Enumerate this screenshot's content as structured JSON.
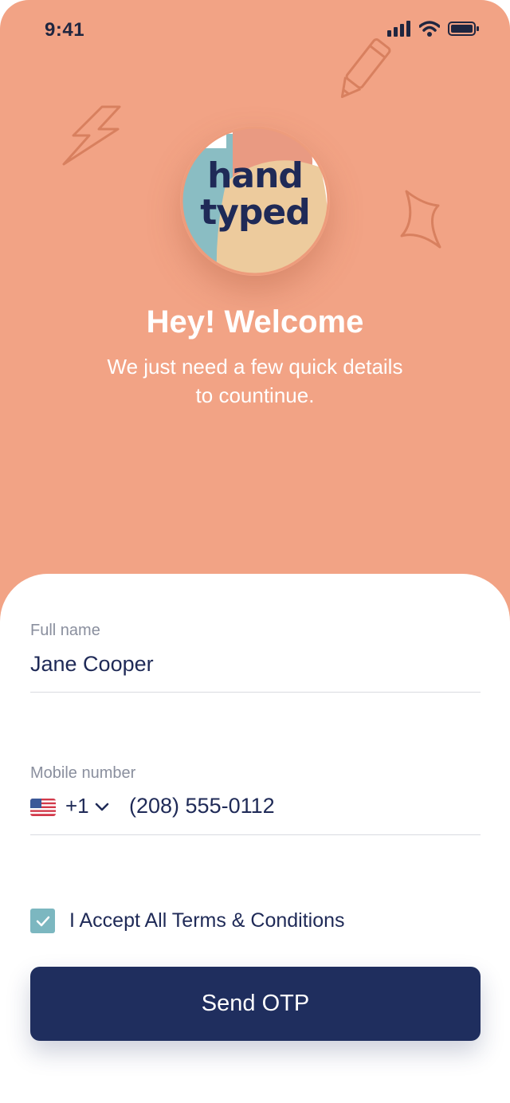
{
  "status_bar": {
    "time": "9:41",
    "icons": [
      "signal-icon",
      "wifi-icon",
      "battery-icon"
    ]
  },
  "logo": {
    "line1": "hand",
    "line2": "typed"
  },
  "welcome": {
    "title": "Hey! Welcome",
    "subtitle_line1": "We just need a few quick details",
    "subtitle_line2": "to countinue."
  },
  "form": {
    "full_name_label": "Full name",
    "full_name_value": "Jane Cooper",
    "mobile_label": "Mobile number",
    "country_code": "+1",
    "country_flag": "us-flag-icon",
    "mobile_value": "(208) 555-0112",
    "terms_label": "I Accept All Terms & Conditions",
    "terms_checked": true,
    "submit_label": "Send OTP"
  },
  "colors": {
    "hero_background": "#F2A385",
    "primary": "#1F2E5E",
    "checkbox": "#7CB7C0",
    "text_dark": "#1F2A57",
    "label_gray": "#8A8F9E"
  }
}
